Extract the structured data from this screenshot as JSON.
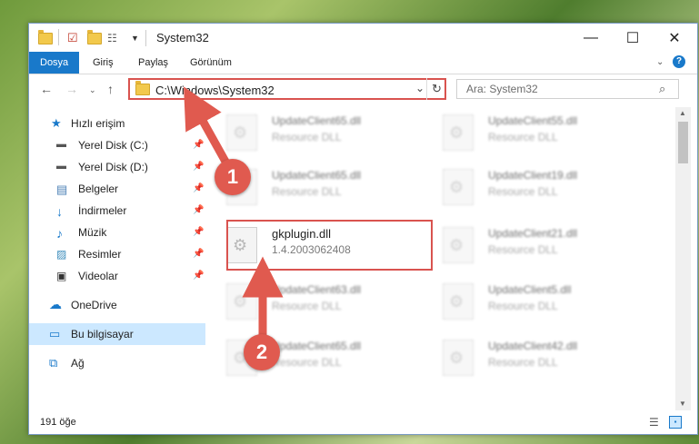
{
  "window": {
    "title": "System32"
  },
  "ribbon": {
    "tabs": [
      "Dosya",
      "Giriş",
      "Paylaş",
      "Görünüm"
    ]
  },
  "address": {
    "path": "C:\\Windows\\System32",
    "search_placeholder": "Ara: System32"
  },
  "navpane": {
    "items": [
      {
        "label": "Hızlı erişim",
        "icon": "star-icon",
        "pinned": false
      },
      {
        "label": "Yerel Disk (C:)",
        "icon": "drive-icon",
        "pinned": true
      },
      {
        "label": "Yerel Disk (D:)",
        "icon": "drive-icon",
        "pinned": true
      },
      {
        "label": "Belgeler",
        "icon": "documents-icon",
        "pinned": true
      },
      {
        "label": "İndirmeler",
        "icon": "download-icon",
        "pinned": true
      },
      {
        "label": "Müzik",
        "icon": "music-icon",
        "pinned": true
      },
      {
        "label": "Resimler",
        "icon": "pictures-icon",
        "pinned": true
      },
      {
        "label": "Videolar",
        "icon": "video-icon",
        "pinned": true
      },
      {
        "label": "OneDrive",
        "icon": "cloud-icon",
        "pinned": false
      },
      {
        "label": "Bu bilgisayar",
        "icon": "computer-icon",
        "pinned": false,
        "selected": true
      },
      {
        "label": "Ağ",
        "icon": "network-icon",
        "pinned": false
      }
    ]
  },
  "files": {
    "left": [
      {
        "name": "UpdateClient65.dll",
        "desc": "Resource DLL"
      },
      {
        "name": "UpdateClient65.dll",
        "desc": "Resource DLL"
      },
      {
        "name": "gkplugin.dll",
        "desc": "1.4.2003062408"
      },
      {
        "name": "UpdateClient63.dll",
        "desc": "Resource DLL"
      },
      {
        "name": "UpdateClient65.dll",
        "desc": "Resource DLL"
      }
    ],
    "right": [
      {
        "name": "UpdateClient55.dll",
        "desc": "Resource DLL"
      },
      {
        "name": "UpdateClient19.dll",
        "desc": "Resource DLL"
      },
      {
        "name": "UpdateClient21.dll",
        "desc": "Resource DLL"
      },
      {
        "name": "UpdateClient5.dll",
        "desc": "Resource DLL"
      },
      {
        "name": "UpdateClient42.dll",
        "desc": "Resource DLL"
      }
    ]
  },
  "status": {
    "count": "191 öğe"
  },
  "annotations": {
    "step1": "1",
    "step2": "2"
  },
  "colors": {
    "accent": "#1979ca",
    "annotation": "#e05a4f",
    "selection": "#cce8ff"
  }
}
